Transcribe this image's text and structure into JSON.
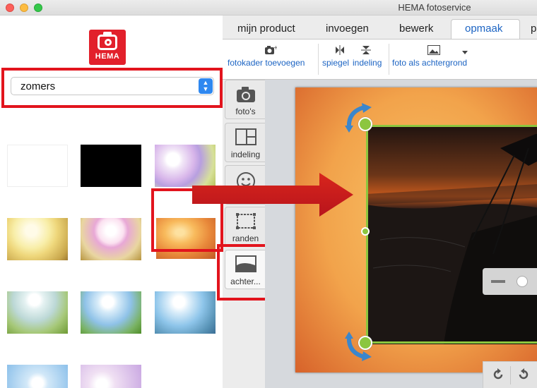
{
  "window": {
    "title": "HEMA fotoservice"
  },
  "brand": {
    "logo_text": "HEMA",
    "color": "#e2202b"
  },
  "background_select": {
    "value": "zomers"
  },
  "thumbnails": [
    {
      "name": "white"
    },
    {
      "name": "black"
    },
    {
      "name": "purple-sun"
    },
    {
      "name": "yellow-sun"
    },
    {
      "name": "pink-sun"
    },
    {
      "name": "orange-sunset"
    },
    {
      "name": "green-field"
    },
    {
      "name": "blue-field"
    },
    {
      "name": "sea"
    },
    {
      "name": "blue-light"
    },
    {
      "name": "purple-light"
    }
  ],
  "side_tabs": [
    {
      "label": "foto's",
      "icon": "camera-icon"
    },
    {
      "label": "indeling",
      "icon": "layout-icon"
    },
    {
      "label": "",
      "icon": "smiley-icon"
    },
    {
      "label": "randen",
      "icon": "frame-icon"
    },
    {
      "label": "achter...",
      "icon": "landscape-icon"
    }
  ],
  "top_tabs": [
    {
      "label": "mijn product"
    },
    {
      "label": "invoegen"
    },
    {
      "label": "bewerk"
    },
    {
      "label": "opmaak"
    },
    {
      "label": "p"
    }
  ],
  "toolbar": {
    "add_photo_frame": "fotokader toevoegen",
    "mirror": "spiegel",
    "layout": "indeling",
    "photo_as_background": "foto als achtergrond"
  },
  "colors": {
    "accent": "#1c64c3",
    "highlight": "#e2141d",
    "handle": "#8cc63f"
  }
}
